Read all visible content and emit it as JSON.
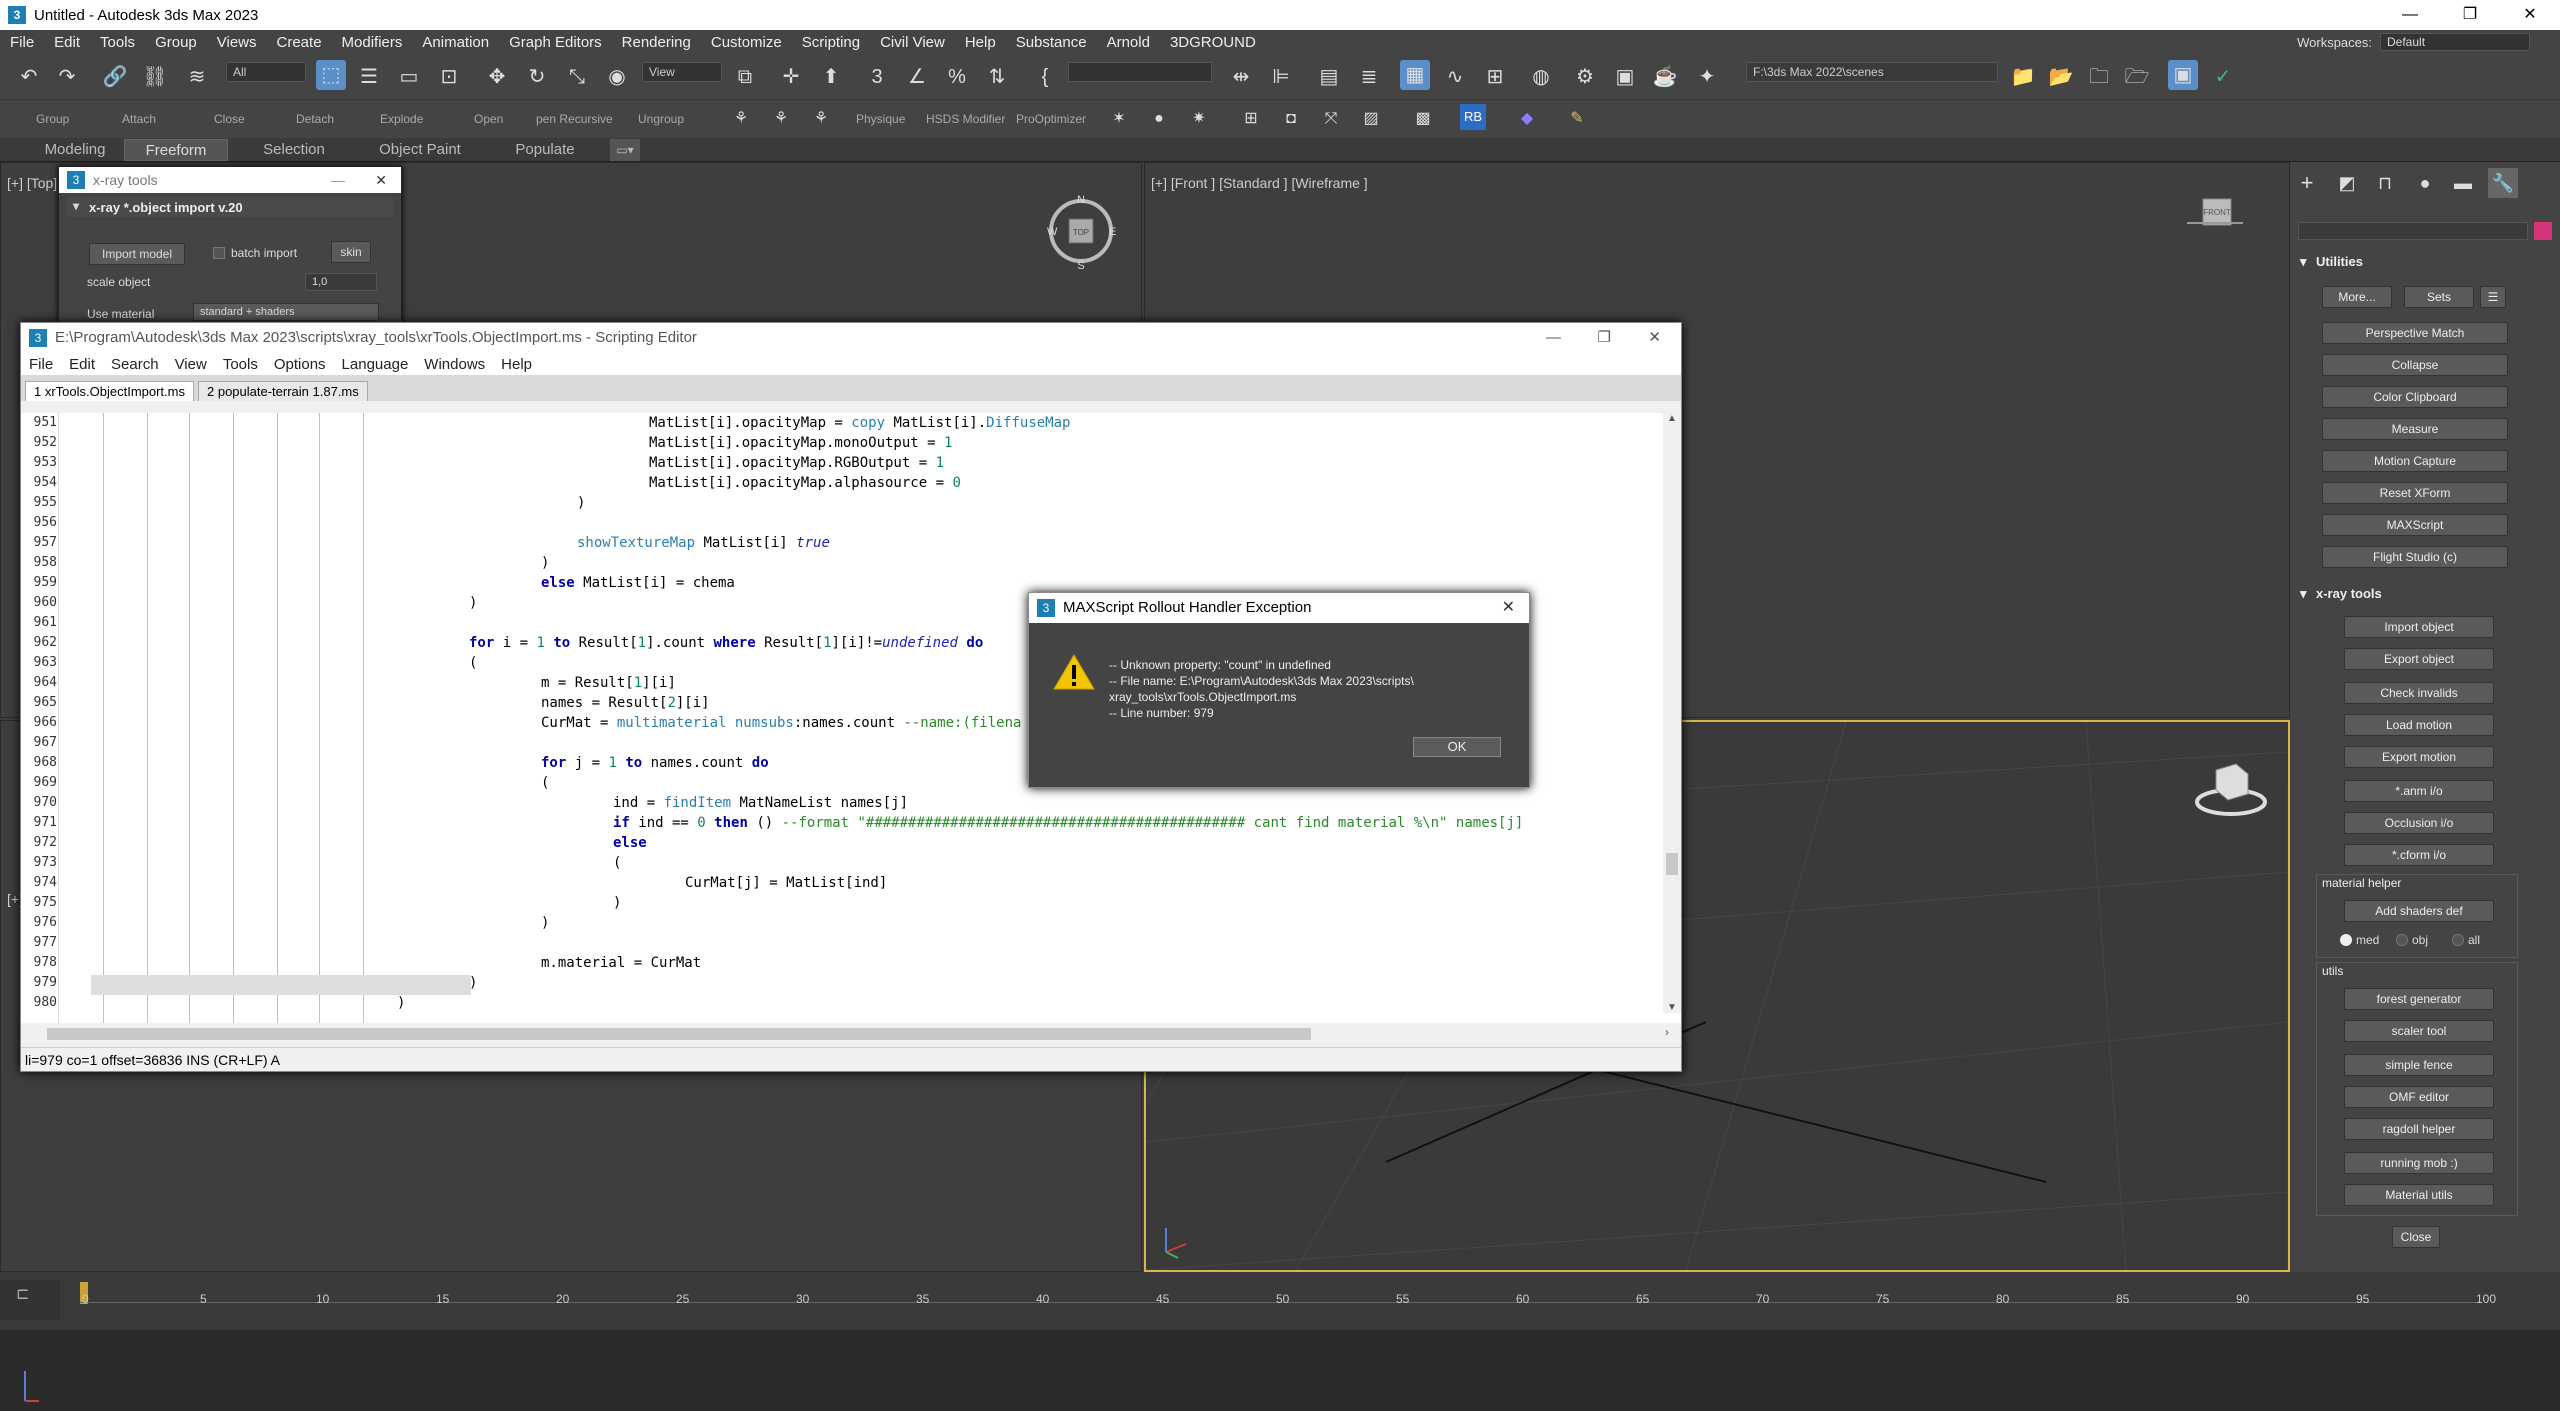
{
  "window": {
    "title": "Untitled - Autodesk 3ds Max 2023",
    "min": "—",
    "max": "❐",
    "close": "✕",
    "app_icon": "3"
  },
  "menubar": {
    "items": [
      "File",
      "Edit",
      "Tools",
      "Group",
      "Views",
      "Create",
      "Modifiers",
      "Animation",
      "Graph Editors",
      "Rendering",
      "Customize",
      "Scripting",
      "Civil View",
      "Help",
      "Substance",
      "Arnold",
      "3DGROUND"
    ],
    "workspaces_label": "Workspaces:",
    "workspaces_value": "Default"
  },
  "toolbar": {
    "selection_filter": "All",
    "ref_coord": "View",
    "path": "F:\\3ds Max 2022\\scenes",
    "rb_label": "RB"
  },
  "toolbar2": {
    "labels": [
      "Group",
      "Attach",
      "Close",
      "Detach",
      "Explode",
      "Open",
      "pen Recursive",
      "Ungroup",
      "Physique",
      "HSDS Modifier",
      "ProOptimizer"
    ]
  },
  "ribbon": {
    "tabs": [
      "Modeling",
      "Freeform",
      "Selection",
      "Object Paint",
      "Populate"
    ],
    "active": "Freeform"
  },
  "viewports": {
    "top_label": "[+] [Top]",
    "front_label": "[+] [Front ] [Standard ] [Wireframe ]",
    "persp_left_label": "[+] [",
    "view_cube_front": "FRONT",
    "view_cube_top": "TOP"
  },
  "right_panel": {
    "utilities_title": "Utilities",
    "more": "More...",
    "sets": "Sets",
    "util_buttons": [
      "Perspective Match",
      "Collapse",
      "Color Clipboard",
      "Measure",
      "Motion Capture",
      "Reset XForm",
      "MAXScript",
      "Flight Studio (c)"
    ],
    "xray_title": "x-ray tools",
    "xray_buttons": [
      "Import object",
      "Export object",
      "Check invalids",
      "Load motion",
      "Export motion",
      "*.anm i/o",
      "Occlusion i/o",
      "*.cform i/o"
    ],
    "material_helper": "material helper",
    "add_shaders": "Add shaders def",
    "radios": [
      "med",
      "obj",
      "all"
    ],
    "utils_title": "utils",
    "utils_buttons": [
      "forest generator",
      "scaler tool",
      "simple fence",
      "OMF editor",
      "ragdoll helper",
      "running mob :)",
      "Material utils"
    ],
    "close": "Close"
  },
  "xray_window": {
    "title": "x-ray tools",
    "rollout": "x-ray *.object import v.20",
    "import_btn": "Import model",
    "batch_label": "batch import",
    "skin_btn": "skin",
    "scale_label": "scale object",
    "scale_value": "1,0",
    "use_material": "Use material",
    "material_value": "standard + shaders"
  },
  "editor": {
    "title": "E:\\Program\\Autodesk\\3ds Max 2023\\scripts\\xray_tools\\xrTools.ObjectImport.ms - Scripting Editor",
    "menu": [
      "File",
      "Edit",
      "Search",
      "View",
      "Tools",
      "Options",
      "Language",
      "Windows",
      "Help"
    ],
    "tabs": [
      "1 xrTools.ObjectImport.ms",
      "2 populate-terrain 1.87.ms"
    ],
    "line_numbers": [
      "951",
      "952",
      "953",
      "954",
      "955",
      "956",
      "957",
      "958",
      "959",
      "960",
      "961",
      "962",
      "963",
      "964",
      "965",
      "966",
      "967",
      "968",
      "969",
      "970",
      "971",
      "972",
      "973",
      "974",
      "975",
      "976",
      "977",
      "978",
      "979",
      "980"
    ],
    "status": "li=979 co=1 offset=36836 INS (CR+LF) A"
  },
  "dialog": {
    "title": "MAXScript Rollout Handler Exception",
    "message": "-- Unknown property: \"count\" in undefined\n-- File name: E:\\Program\\Autodesk\\3ds Max 2023\\scripts\\\nxray_tools\\xrTools.ObjectImport.ms\n-- Line number: 979",
    "ok": "OK",
    "close": "✕"
  },
  "timeline": {
    "ticks": [
      "0",
      "5",
      "10",
      "15",
      "20",
      "25",
      "30",
      "35",
      "40",
      "45",
      "50",
      "55",
      "60",
      "65",
      "70",
      "75",
      "80",
      "85",
      "90",
      "95",
      "100"
    ]
  }
}
